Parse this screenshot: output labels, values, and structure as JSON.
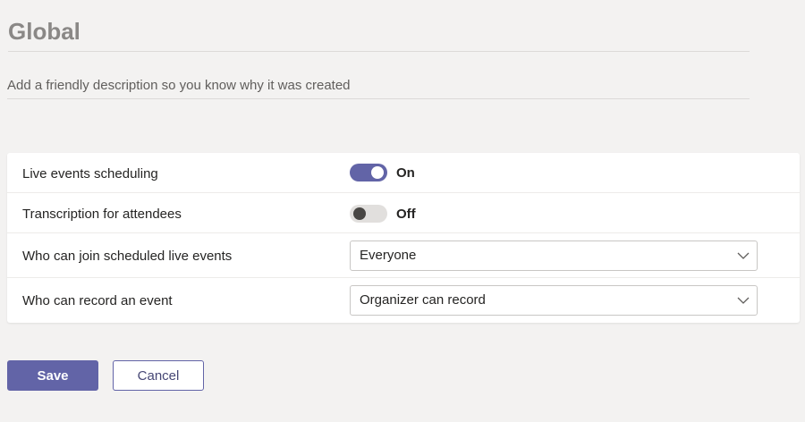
{
  "policy": {
    "name": "Global",
    "description_placeholder": "Add a friendly description so you know why it was created"
  },
  "settings": {
    "live_events_scheduling": {
      "label": "Live events scheduling",
      "state": "On",
      "enabled": true
    },
    "transcription": {
      "label": "Transcription for attendees",
      "state": "Off",
      "enabled": false
    },
    "who_can_join": {
      "label": "Who can join scheduled live events",
      "value": "Everyone",
      "icon": "chevron-down-icon"
    },
    "who_can_record": {
      "label": "Who can record an event",
      "value": "Organizer can record",
      "icon": "chevron-down-icon"
    }
  },
  "actions": {
    "save_label": "Save",
    "cancel_label": "Cancel"
  },
  "colors": {
    "accent": "#6264a7",
    "background": "#f3f2f1",
    "card": "#ffffff"
  }
}
